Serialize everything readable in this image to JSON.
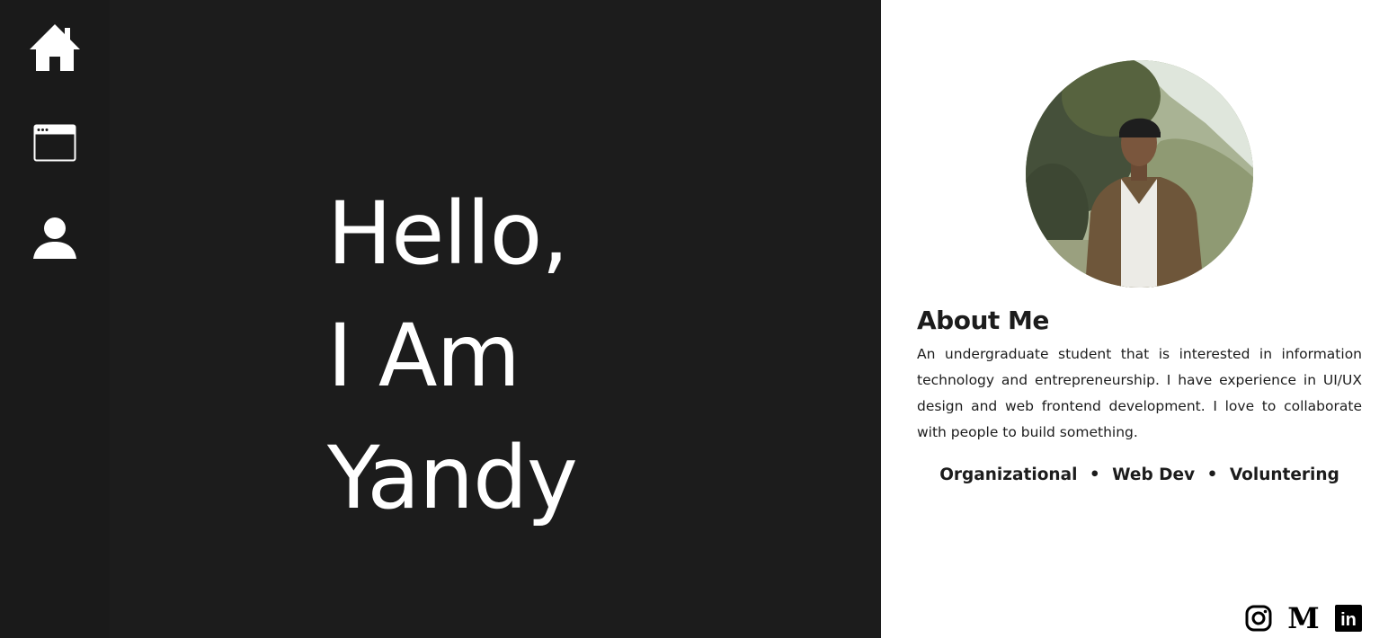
{
  "nav": {
    "items": [
      {
        "name": "home",
        "icon": "home-icon"
      },
      {
        "name": "projects",
        "icon": "browser-window-icon"
      },
      {
        "name": "profile",
        "icon": "user-icon"
      }
    ]
  },
  "hero": {
    "line1": "Hello,",
    "line2": "I Am",
    "line3": "Yandy"
  },
  "about": {
    "photo_icon": "profile-photo",
    "title": "About Me",
    "description": "An undergraduate student that is interested in information technology and entrepreneurship. I have experience in UI/UX design and web frontend development. I love to collaborate with people to build something.",
    "tags": [
      "Organizational",
      "Web Dev",
      "Voluntering"
    ],
    "separator": "•"
  },
  "socials": {
    "items": [
      {
        "name": "instagram",
        "icon": "instagram-icon"
      },
      {
        "name": "medium",
        "icon": "medium-icon",
        "glyph": "M"
      },
      {
        "name": "linkedin",
        "icon": "linkedin-icon",
        "glyph": "in"
      }
    ]
  },
  "colors": {
    "dark_bg": "#1c1c1c",
    "light_bg": "#ffffff",
    "text_dark": "#1c1c1c",
    "text_light": "#ffffff"
  }
}
